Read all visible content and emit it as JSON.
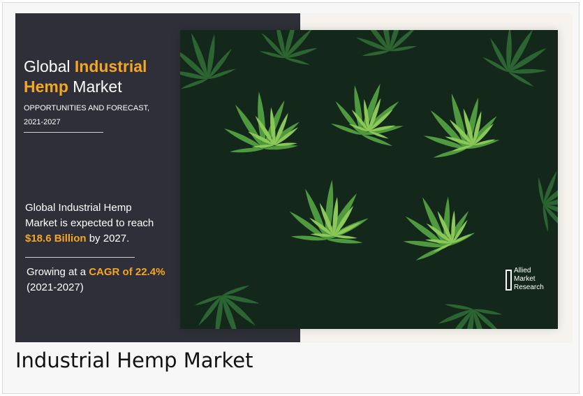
{
  "card": {
    "title_line1_plain": "Global ",
    "title_line1_accent": "Industrial",
    "title_line2_accent": "Hemp",
    "title_line2_plain": " Market",
    "subtitle_line1": "OPPORTUNITIES AND FORECAST,",
    "subtitle_line2": "2021-2027",
    "reach_line1": "Global Industrial Hemp",
    "reach_line2": "Market is expected to reach",
    "reach_value": "$18.6 Billion",
    "reach_suffix": " by 2027.",
    "cagr_prefix": "Growing at a ",
    "cagr_value": "CAGR of 22.4%",
    "cagr_period": "(2021-2027)"
  },
  "logo": {
    "line1": "Allied",
    "line2": "Market",
    "line3": "Research"
  },
  "caption": "Industrial Hemp Market",
  "colors": {
    "accent": "#f5a623",
    "panel": "#2e2f38"
  }
}
